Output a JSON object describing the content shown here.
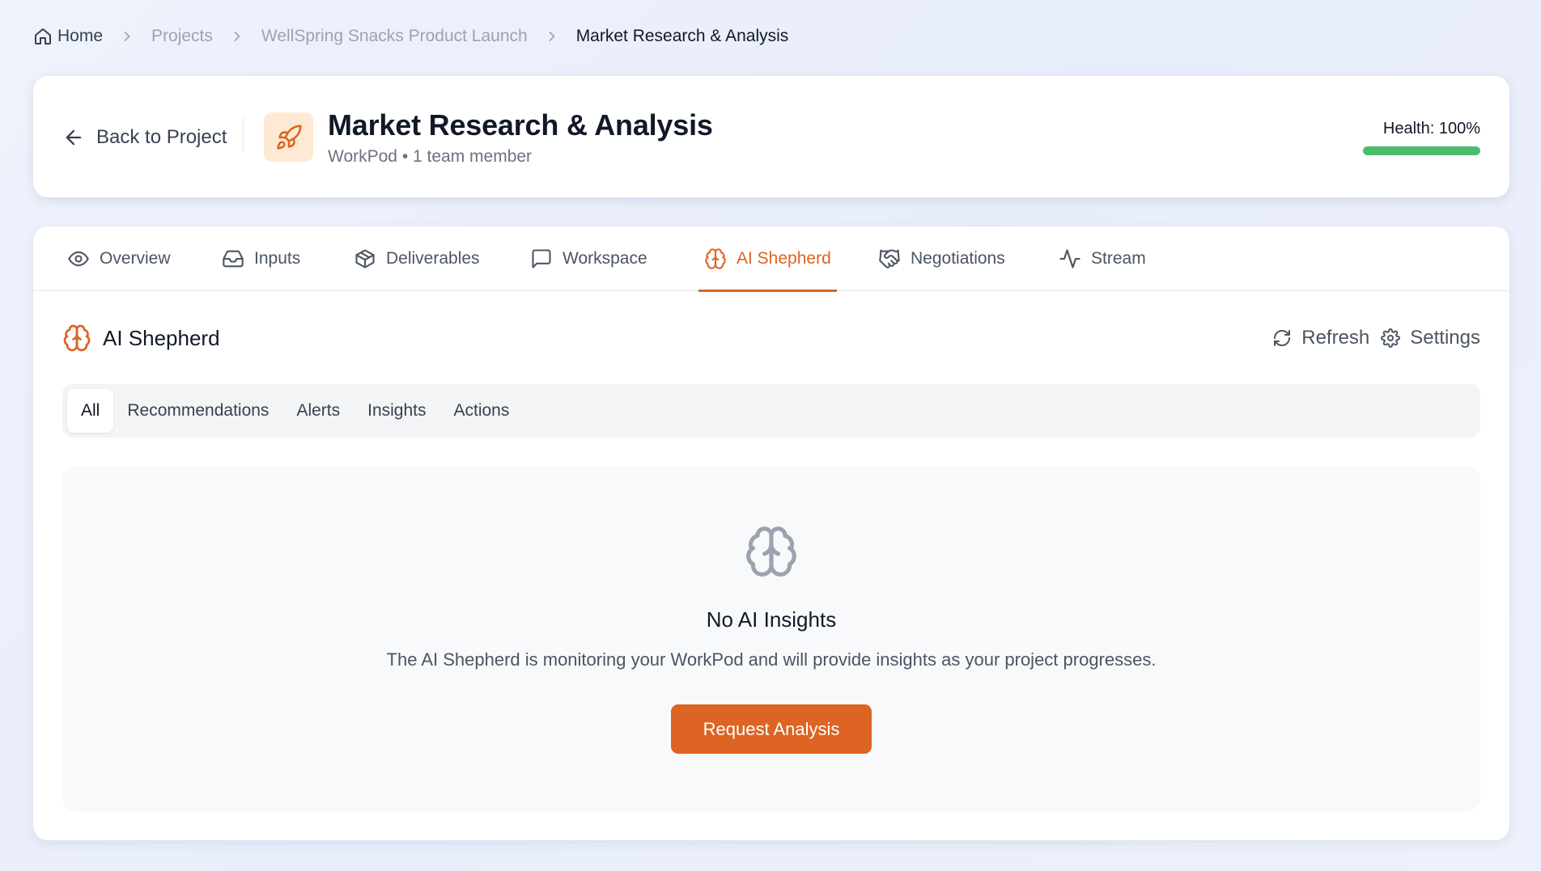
{
  "breadcrumb": {
    "home": "Home",
    "projects": "Projects",
    "project": "WellSpring Snacks Product Launch",
    "current": "Market Research & Analysis"
  },
  "header": {
    "back_label": "Back to Project",
    "title": "Market Research & Analysis",
    "subtitle": "WorkPod • 1 team member",
    "icon": "rocket-icon",
    "health_label": "Health: 100%",
    "health_value": 100,
    "health_color": "#4cbb6c",
    "icon_bg": "#fde9d4"
  },
  "tabs": [
    {
      "label": "Overview",
      "icon": "eye-icon"
    },
    {
      "label": "Inputs",
      "icon": "inbox-icon"
    },
    {
      "label": "Deliverables",
      "icon": "package-icon"
    },
    {
      "label": "Workspace",
      "icon": "message-square-icon"
    },
    {
      "label": "AI Shepherd",
      "icon": "brain-icon",
      "active": true
    },
    {
      "label": "Negotiations",
      "icon": "handshake-icon"
    },
    {
      "label": "Stream",
      "icon": "activity-icon"
    }
  ],
  "section": {
    "title": "AI Shepherd",
    "refresh_label": "Refresh",
    "settings_label": "Settings"
  },
  "filters": [
    "All",
    "Recommendations",
    "Alerts",
    "Insights",
    "Actions"
  ],
  "active_filter": "All",
  "empty_state": {
    "icon": "brain-icon",
    "title": "No AI Insights",
    "description": "The AI Shepherd is monitoring your WorkPod and will provide insights as your project progresses.",
    "button_label": "Request Analysis"
  },
  "colors": {
    "accent": "#dd6422",
    "text": "#111827",
    "muted": "#6b7280"
  }
}
